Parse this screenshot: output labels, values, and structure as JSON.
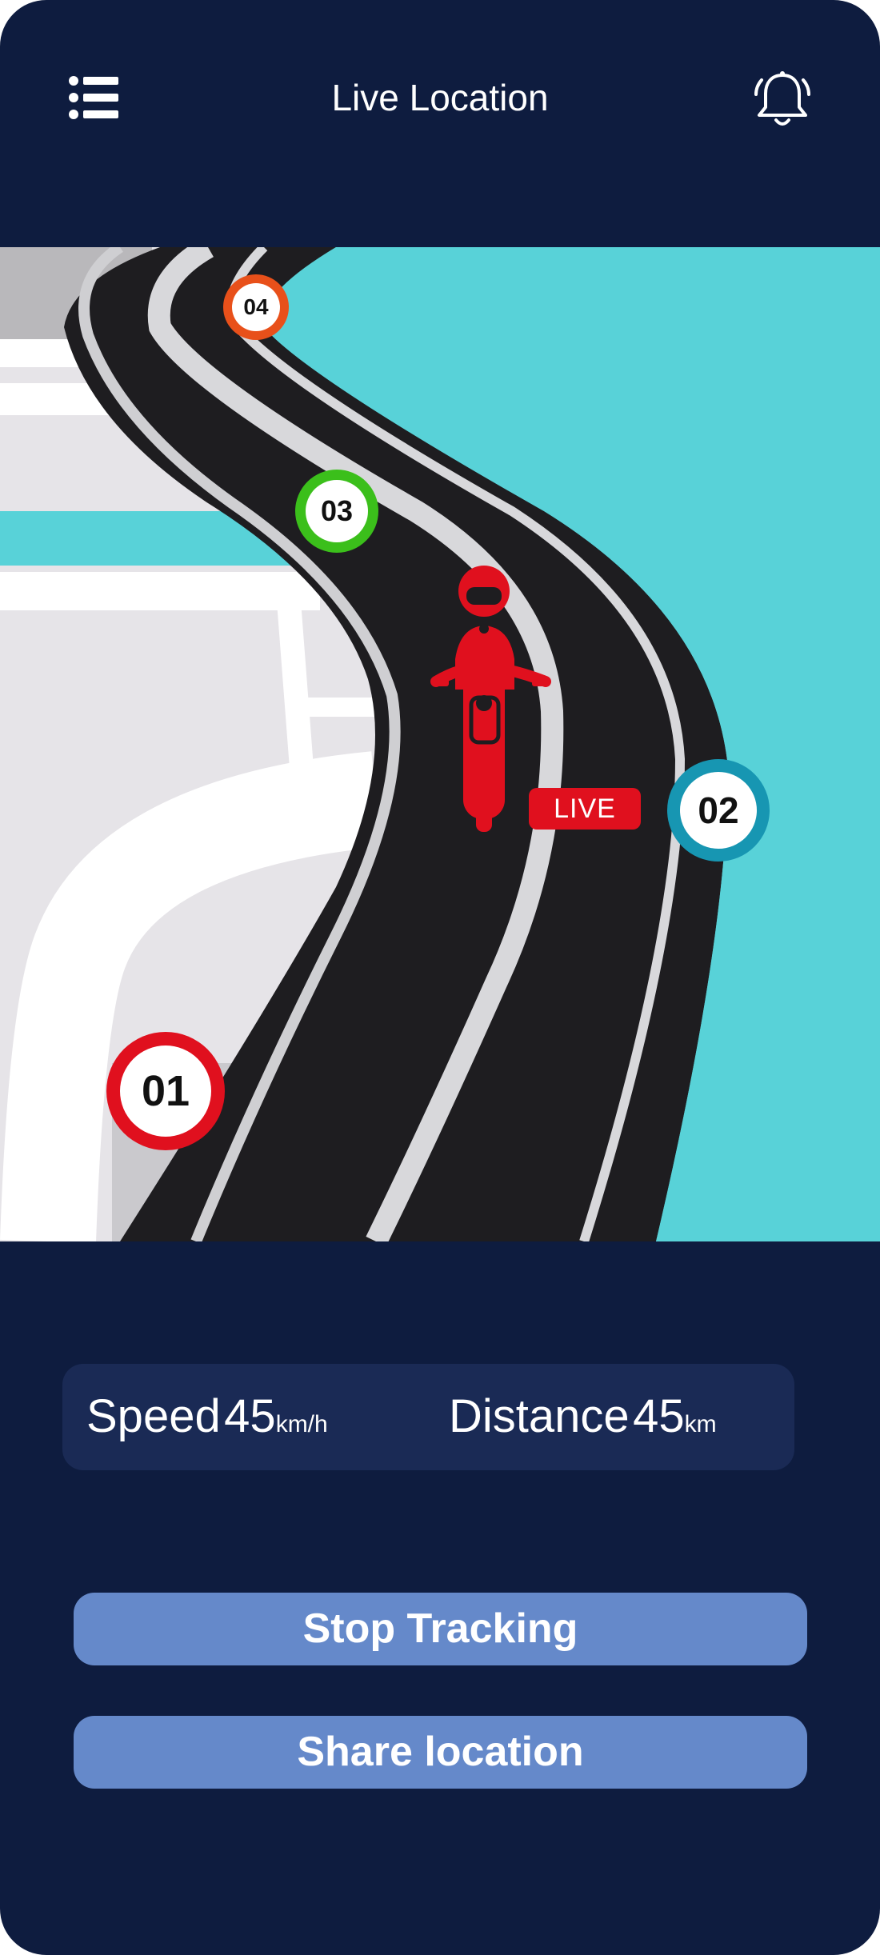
{
  "header": {
    "title": "Live Location",
    "menu_icon": "list-icon",
    "notification_icon": "bell-icon"
  },
  "map": {
    "live_badge": "LIVE",
    "rider_icon": "motorcycle-rider-icon",
    "pins": [
      {
        "label": "01",
        "color": "#e0101e"
      },
      {
        "label": "02",
        "color": "#1796b2"
      },
      {
        "label": "03",
        "color": "#3bbf1b"
      },
      {
        "label": "04",
        "color": "#e8501a"
      }
    ],
    "colors": {
      "water": "#58d2d8",
      "road": "#1e1d20",
      "land": "#e6e4e8"
    }
  },
  "stats": {
    "speed": {
      "label": "Speed",
      "value": "45",
      "unit": "km/h"
    },
    "distance": {
      "label": "Distance",
      "value": "45",
      "unit": "km"
    }
  },
  "actions": {
    "stop_label": "Stop Tracking",
    "share_label": "Share location"
  },
  "theme": {
    "background": "#0e1c3f",
    "card": "#1a2a55",
    "button": "#6589ca"
  }
}
